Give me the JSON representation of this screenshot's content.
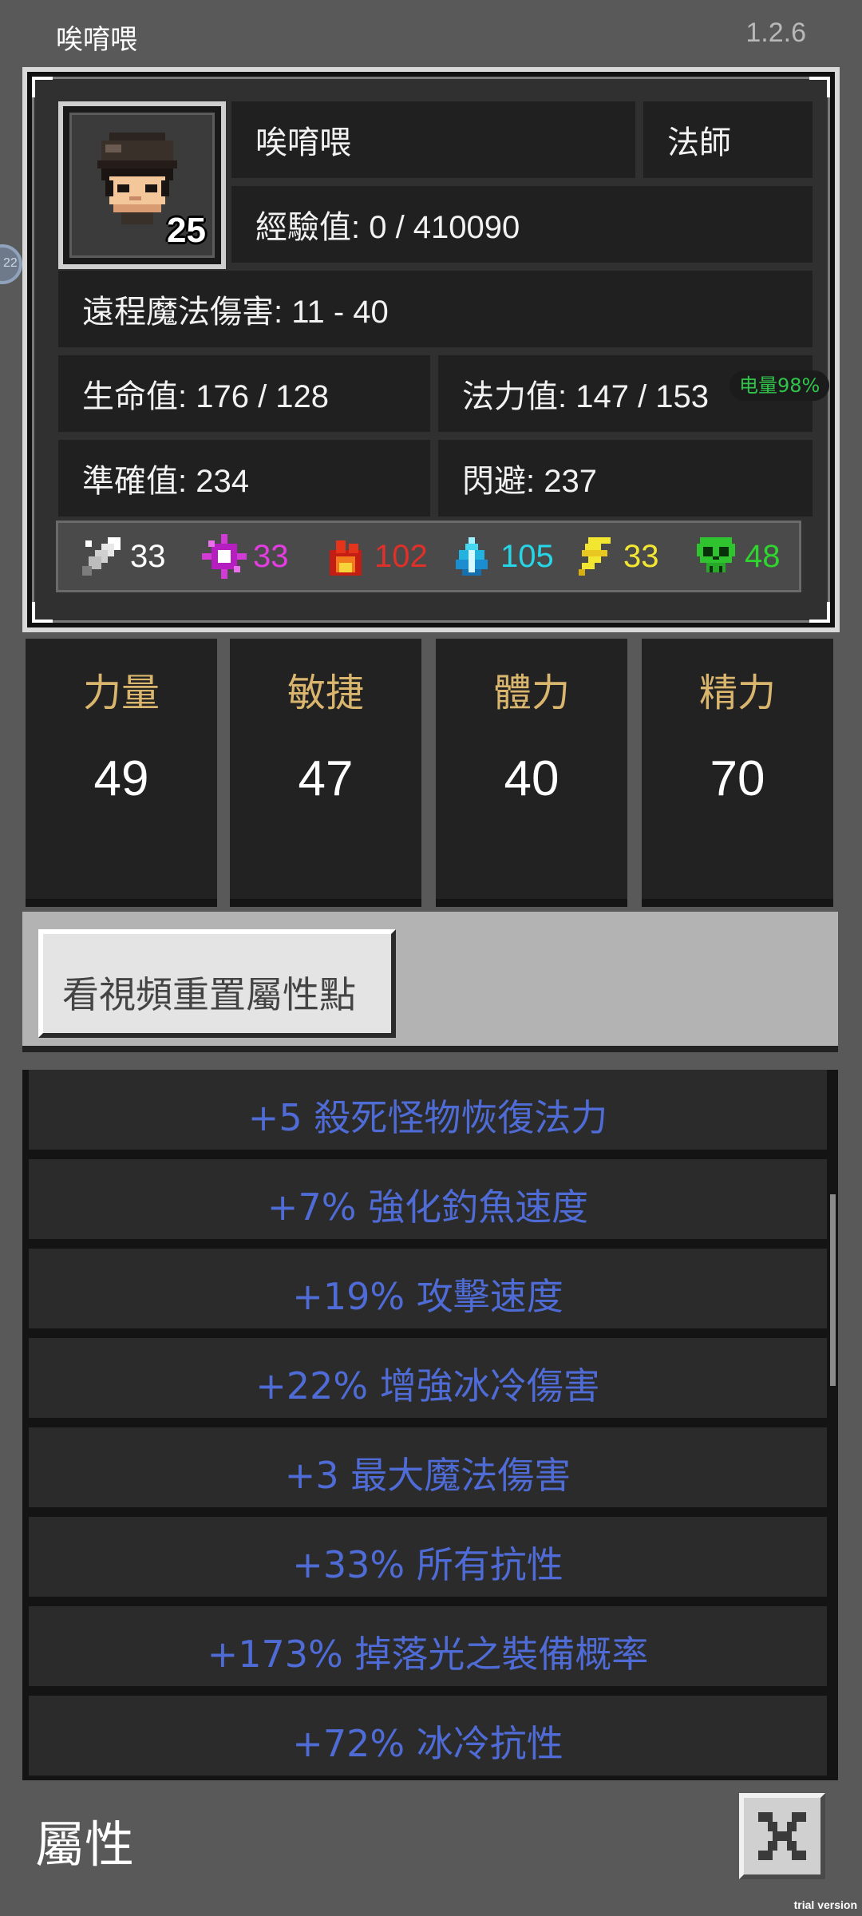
{
  "header": {
    "title": "唉唷喂",
    "version": "1.2.6"
  },
  "side_bubble": {
    "label": "22"
  },
  "character": {
    "name": "唉唷喂",
    "class": "法師",
    "level": "25",
    "experience": "經驗值: 0 / 410090",
    "damage": "遠程魔法傷害: 11 - 40",
    "hp": "生命值: 176 / 128",
    "mp": "法力值: 147 / 153",
    "accuracy": "準確值: 234",
    "dodge": "閃避: 237",
    "battery": "电量98%"
  },
  "resistances": [
    {
      "icon": "sword-icon",
      "value": "33",
      "color": "#ffffff"
    },
    {
      "icon": "magic-spark-icon",
      "value": "33",
      "color": "#e33ce0"
    },
    {
      "icon": "fire-icon",
      "value": "102",
      "color": "#e0302a"
    },
    {
      "icon": "ice-crystal-icon",
      "value": "105",
      "color": "#27d6e6"
    },
    {
      "icon": "lightning-icon",
      "value": "33",
      "color": "#f3e631"
    },
    {
      "icon": "poison-skull-icon",
      "value": "48",
      "color": "#2fd42f"
    }
  ],
  "stats": [
    {
      "name": "力量",
      "value": "49"
    },
    {
      "name": "敏捷",
      "value": "47"
    },
    {
      "name": "體力",
      "value": "40"
    },
    {
      "name": "精力",
      "value": "70"
    }
  ],
  "reset_button": {
    "label": "看視頻重置屬性點"
  },
  "bonuses": [
    "+5 殺死怪物恢復法力",
    "+7% 強化釣魚速度",
    "+19% 攻擊速度",
    "+22% 增強冰冷傷害",
    "+3 最大魔法傷害",
    "+33% 所有抗性",
    "+173% 掉落光之裝備概率",
    "+72% 冰冷抗性"
  ],
  "footer": {
    "title": "屬性",
    "watermark": "trial version"
  }
}
